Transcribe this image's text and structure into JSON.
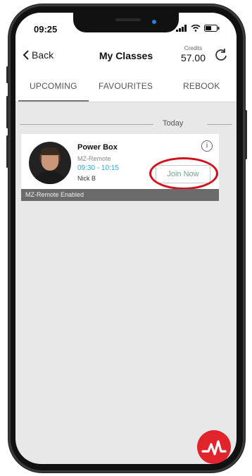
{
  "status": {
    "time": "09:25"
  },
  "nav": {
    "back_label": "Back",
    "title": "My Classes",
    "credits_label": "Credits",
    "credits_value": "57.00"
  },
  "tabs": [
    {
      "label": "UPCOMING"
    },
    {
      "label": "FAVOURITES"
    },
    {
      "label": "REBOOK"
    }
  ],
  "section": {
    "day": "Today"
  },
  "class_card": {
    "name": "Power Box",
    "location": "MZ-Remote",
    "time": "09:30 - 10:15",
    "instructor": "Nick B",
    "join_label": "Join Now",
    "footer": "MZ-Remote Enabled"
  },
  "colors": {
    "accent": "#e1242b",
    "time": "#3aa7c9",
    "join_text": "#6aa58a",
    "highlight_circle": "#d0101c"
  }
}
